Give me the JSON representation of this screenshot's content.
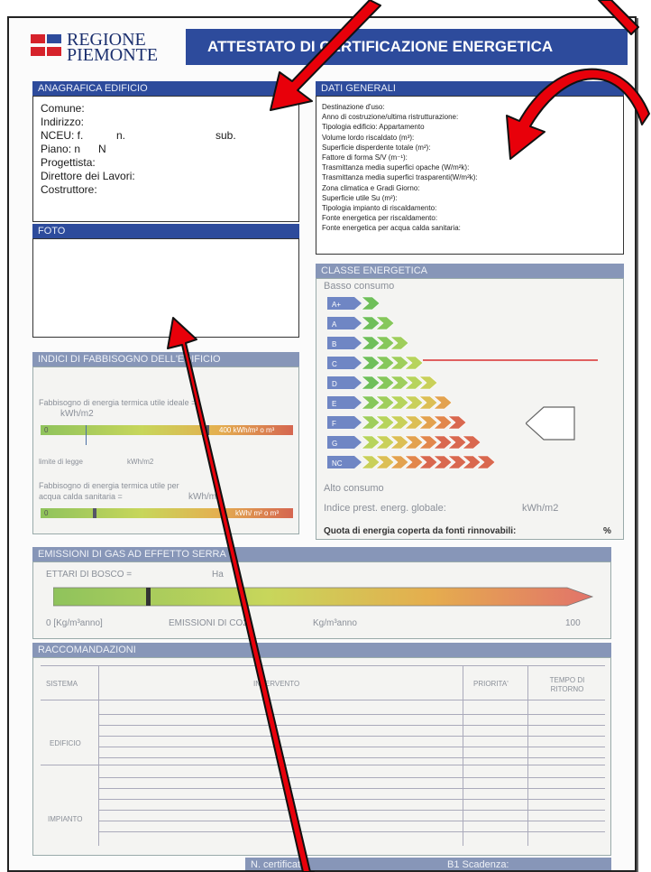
{
  "logo": {
    "line1": "REGIONE",
    "line2": "PIEMONTE"
  },
  "title": "ATTESTATO DI CERTIFICAZIONE ENERGETICA",
  "anagrafica": {
    "header": "ANAGRAFICA EDIFICIO",
    "comune": "Comune:",
    "indirizzo": "Indirizzo:",
    "nceu": "NCEU: f.",
    "nceu_n": "n.",
    "nceu_sub": "sub.",
    "piano": "Piano: n",
    "piano_n": "N",
    "progettista": "Progettista:",
    "direttore": "Direttore dei Lavori:",
    "costruttore": "Costruttore:"
  },
  "dati_generali": {
    "header": "DATI GENERALI",
    "lines": [
      "Destinazione d'uso:",
      "Anno di costruzione/ultima ristrutturazione:",
      "Tipologia edificio:  Appartamento",
      "Volume lordo riscaldato (m³):",
      "Superficie disperdente totale (m²):",
      "Fattore di forma S/V (m⁻¹):",
      "Trasmittanza media superfici opache (W/m²k):",
      "Trasmittanza media superfici trasparenti(W/m²k):",
      "Zona climatica e Gradi Giorno:",
      "Superficie utile Su (m²):",
      "Tipologia impianto di riscaldamento:",
      "Fonte energetica per riscaldamento:",
      "Fonte energetica per acqua calda sanitaria:"
    ]
  },
  "foto": {
    "header": "FOTO"
  },
  "classe": {
    "header": "CLASSE ENERGETICA",
    "basso": "Basso consumo",
    "alto": "Alto consumo",
    "classes": [
      "A+",
      "A",
      "B",
      "C",
      "D",
      "E",
      "F",
      "G",
      "NC"
    ],
    "indice_label": "Indice prest. energ. globale:",
    "indice_unit": "kWh/m2",
    "quota_label": "Quota di energia coperta da fonti rinnovabili:",
    "quota_unit": "%"
  },
  "indici": {
    "header": "INDICI DI FABBISOGNO DELL'EDIFICIO",
    "line1": "Fabbisogno di energia termica utile ideale =",
    "line1_unit": "kWh/m2",
    "bar1_start": "0",
    "bar1_end": "400 kWh/m² o m³",
    "limite": "limite di legge",
    "limite_unit": "kWh/m2",
    "line2a": "Fabbisogno di energia termica utile per",
    "line2b": "acqua calda sanitaria =",
    "line2_unit": "kWh/m2",
    "bar2_start": "0",
    "bar2_end": "kWh/ m² o m³"
  },
  "emissioni": {
    "header": "EMISSIONI DI GAS AD EFFETTO SERRA",
    "ettari": "ETTARI DI BOSCO =",
    "ha": "Ha",
    "scale_start": "0 [Kg/m³anno]",
    "emissioni_label": "EMISSIONI DI CO2",
    "unit": "Kg/m³anno",
    "scale_end": "100"
  },
  "raccomandazioni": {
    "header": "RACCOMANDAZIONI",
    "col_sistema": "SISTEMA",
    "col_intervento": "INTERVENTO",
    "col_priorita": "PRIORITA'",
    "col_tempo": "TEMPO DI RITORNO",
    "row_edificio": "EDIFICIO",
    "row_impianto": "IMPIANTO"
  },
  "footer": {
    "certificato": "N. certificato:",
    "scadenza": "B1 Scadenza:"
  },
  "colors": {
    "header_blue": "#2d4b9c",
    "arrow_red": "#e8000a"
  }
}
